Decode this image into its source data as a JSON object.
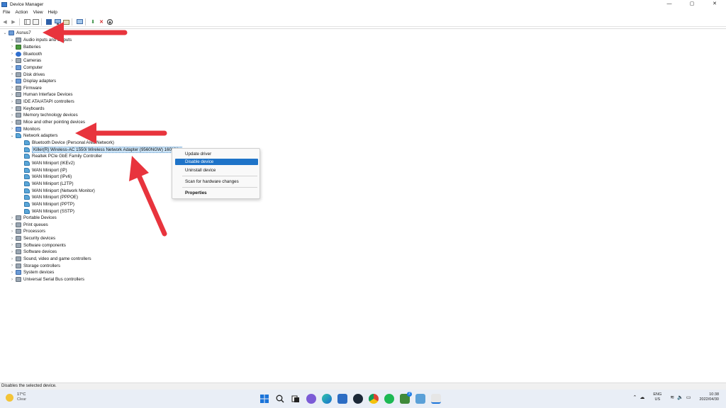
{
  "window": {
    "title": "Device Manager",
    "controls": [
      "—",
      "▢",
      "✕"
    ]
  },
  "menubar": [
    "File",
    "Action",
    "View",
    "Help"
  ],
  "toolbar": {
    "icons": [
      "back-arrow-icon",
      "forward-arrow-icon",
      "show-hide-tree-icon",
      "properties-icon",
      "help-icon",
      "computer-icon",
      "update-driver-icon",
      "scan-hardware-icon",
      "enable-device-icon",
      "uninstall-device-icon",
      "disable-device-icon"
    ]
  },
  "tree": {
    "root": "Asnus7",
    "categories": [
      {
        "label": "Audio inputs and outputs",
        "icon": "dev"
      },
      {
        "label": "Batteries",
        "icon": "bat"
      },
      {
        "label": "Bluetooth",
        "icon": "bt"
      },
      {
        "label": "Cameras",
        "icon": "dev"
      },
      {
        "label": "Computer",
        "icon": "comp"
      },
      {
        "label": "Disk drives",
        "icon": "dev"
      },
      {
        "label": "Display adapters",
        "icon": "comp"
      },
      {
        "label": "Firmware",
        "icon": "dev"
      },
      {
        "label": "Human Interface Devices",
        "icon": "dev"
      },
      {
        "label": "IDE ATA/ATAPI controllers",
        "icon": "dev"
      },
      {
        "label": "Keyboards",
        "icon": "dev"
      },
      {
        "label": "Memory technology devices",
        "icon": "dev"
      },
      {
        "label": "Mice and other pointing devices",
        "icon": "dev"
      },
      {
        "label": "Monitors",
        "icon": "comp"
      },
      {
        "label": "Network adapters",
        "icon": "net",
        "expanded": true
      }
    ],
    "network_children": [
      "Bluetooth Device (Personal Area Network)",
      "Killer(R) Wireless-AC 1550i Wireless Network Adapter (9560NGW) 160MHz",
      "Realtek PCIe GbE Family Controller",
      "WAN Miniport (IKEv2)",
      "WAN Miniport (IP)",
      "WAN Miniport (IPv6)",
      "WAN Miniport (L2TP)",
      "WAN Miniport (Network Monitor)",
      "WAN Miniport (PPPOE)",
      "WAN Miniport (PPTP)",
      "WAN Miniport (SSTP)"
    ],
    "more_categories": [
      {
        "label": "Portable Devices",
        "icon": "dev"
      },
      {
        "label": "Print queues",
        "icon": "dev"
      },
      {
        "label": "Processors",
        "icon": "dev"
      },
      {
        "label": "Security devices",
        "icon": "dev"
      },
      {
        "label": "Software components",
        "icon": "dev"
      },
      {
        "label": "Software devices",
        "icon": "dev"
      },
      {
        "label": "Sound, video and game controllers",
        "icon": "dev"
      },
      {
        "label": "Storage controllers",
        "icon": "dev"
      },
      {
        "label": "System devices",
        "icon": "comp"
      },
      {
        "label": "Universal Serial Bus controllers",
        "icon": "dev"
      }
    ]
  },
  "context_menu": {
    "update_driver": "Update driver",
    "disable_device": "Disable device",
    "uninstall_device": "Uninstall device",
    "scan": "Scan for hardware changes",
    "properties": "Properties"
  },
  "statusbar": "Disables the selected device.",
  "taskbar": {
    "weather_temp": "17°C",
    "weather_desc": "Clear",
    "apps": [
      "windows-start-icon",
      "search-icon",
      "task-view-icon",
      "chat-icon",
      "edge-icon",
      "store-icon",
      "steam-icon",
      "chrome-icon",
      "spotify-icon",
      "game-icon",
      "screenshot-tool-icon",
      "printer-app-icon"
    ],
    "badge": "2",
    "lang_top": "ENG",
    "lang_bottom": "US",
    "time": "10:38",
    "date": "2022/04/30"
  },
  "colors": {
    "annotation_arrow": "#e8343d",
    "selection_highlight": "#1e73c8"
  }
}
